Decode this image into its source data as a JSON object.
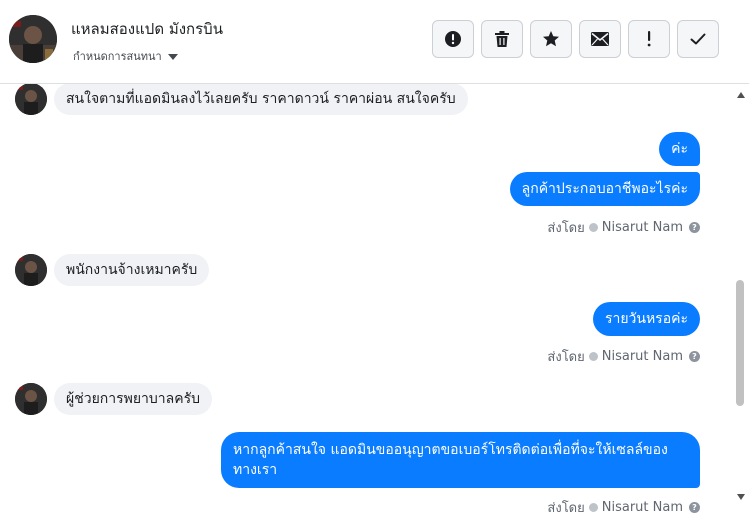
{
  "header": {
    "contact_name": "แหลมสองแปด มังกรบิน",
    "assign_label": "กำหนดการสนทนา",
    "actions": [
      {
        "name": "report-spam-button",
        "icon": "exclamation-circle-icon"
      },
      {
        "name": "delete-button",
        "icon": "trash-icon"
      },
      {
        "name": "star-button",
        "icon": "star-icon"
      },
      {
        "name": "mark-unread-button",
        "icon": "envelope-icon"
      },
      {
        "name": "follow-up-button",
        "icon": "exclamation-icon"
      },
      {
        "name": "mark-done-button",
        "icon": "check-icon"
      }
    ]
  },
  "messages": [
    {
      "dir": "in",
      "text": "สนใจตามที่แอดมินลงไว้เลยครับ ราคาดาวน์ ราคาผ่อน สนใจครับ"
    },
    {
      "dir": "out",
      "text": "ค่ะ"
    },
    {
      "dir": "out",
      "text": "ลูกค้าประกอบอาชีพอะไรค่ะ"
    },
    {
      "dir": "in",
      "text": "พนักงานจ้างเหมาครับ"
    },
    {
      "dir": "out",
      "text": "รายวันหรอค่ะ"
    },
    {
      "dir": "in",
      "text": "ผู้ช่วยการพยาบาลครับ"
    },
    {
      "dir": "out",
      "text": "หากลูกค้าสนใจ แอดมินขออนุญาตขอเบอร์โทรติดต่อเพื่อที่จะให้เซลล์ของทางเรา"
    }
  ],
  "sent_by": {
    "prefix": "ส่งโดย",
    "agent": "Nisarut Nam",
    "help": "?"
  },
  "colors": {
    "outgoing_bubble": "#0a7cff",
    "incoming_bubble": "#f0f2f5"
  }
}
